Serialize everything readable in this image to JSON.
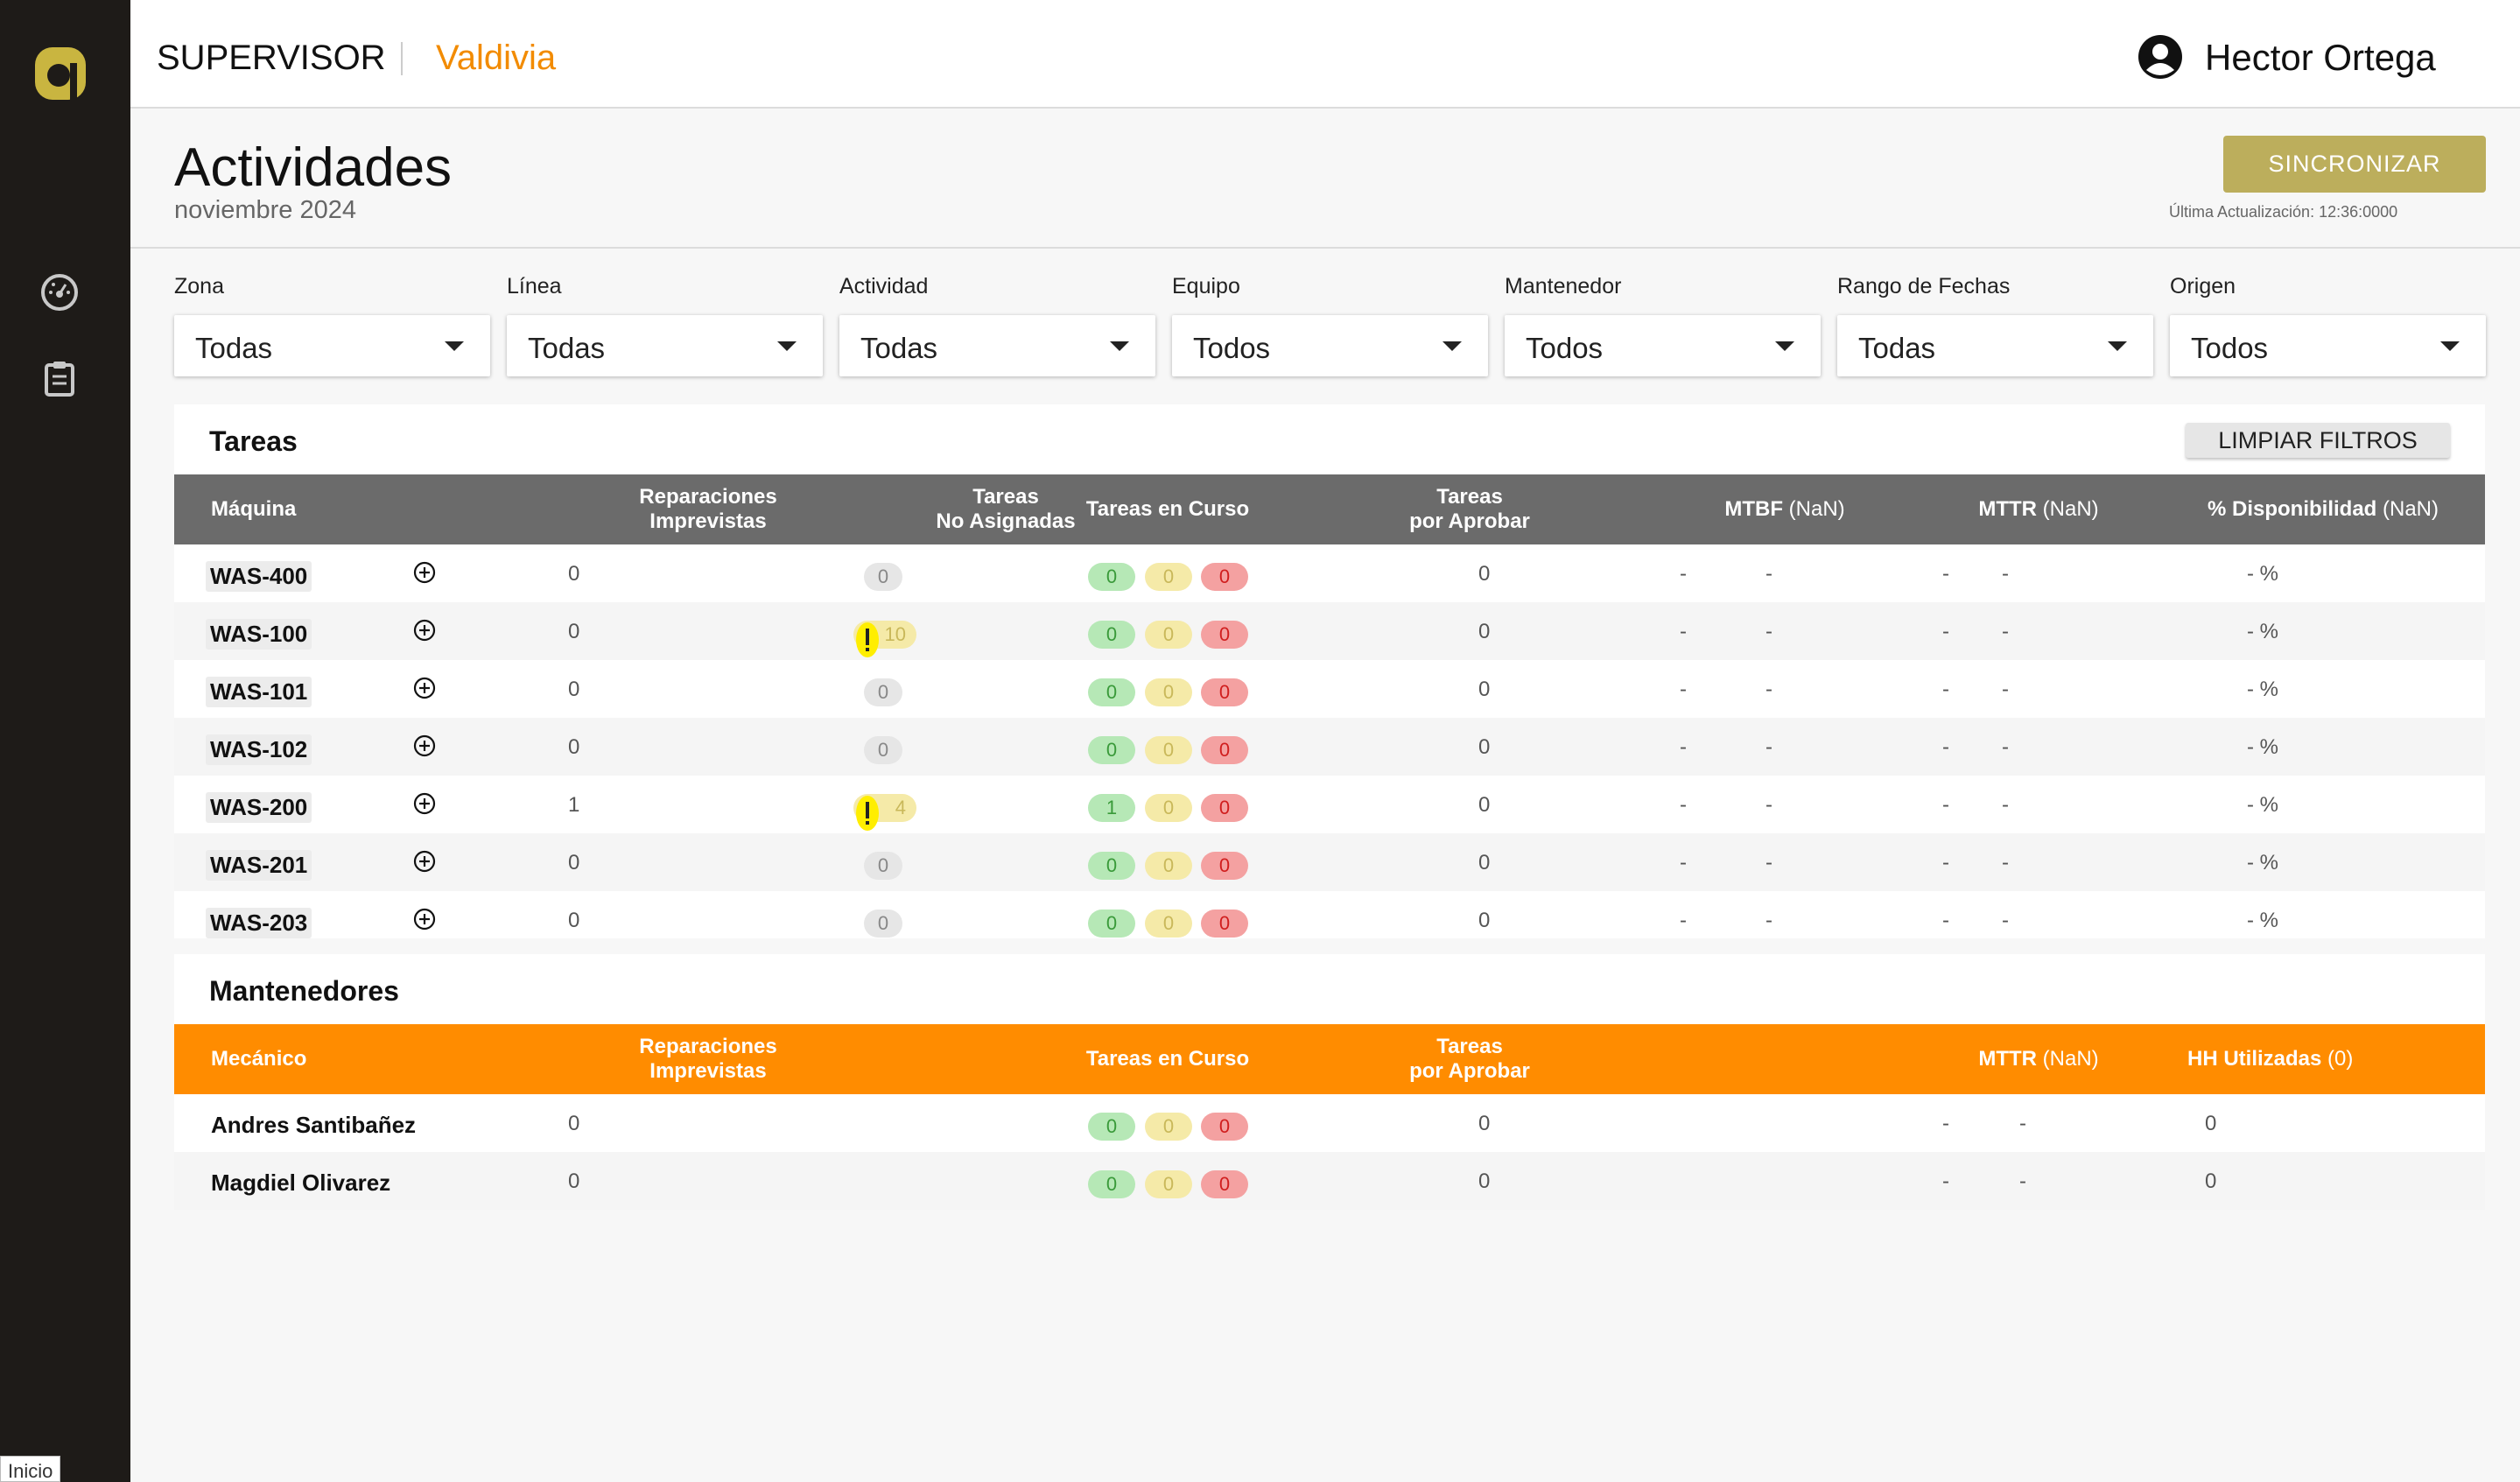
{
  "header": {
    "role": "SUPERVISOR",
    "site": "Valdivia",
    "user": "Hector Ortega"
  },
  "page": {
    "title": "Actividades",
    "period": "noviembre 2024",
    "sync_label": "SINCRONIZAR",
    "last_update": "Última Actualización: 12:36:0000"
  },
  "sidebar": {
    "items": [
      {
        "icon": "dashboard-gauge-icon"
      },
      {
        "icon": "clipboard-icon"
      }
    ],
    "status": "Inicio"
  },
  "filters": [
    {
      "label": "Zona",
      "value": "Todas"
    },
    {
      "label": "Línea",
      "value": "Todas"
    },
    {
      "label": "Actividad",
      "value": "Todas"
    },
    {
      "label": "Equipo",
      "value": "Todos"
    },
    {
      "label": "Mantenedor",
      "value": "Todos"
    },
    {
      "label": "Rango de Fechas",
      "value": "Todas"
    },
    {
      "label": "Origen",
      "value": "Todos"
    }
  ],
  "tasks": {
    "title": "Tareas",
    "clear_label": "LIMPIAR FILTROS",
    "headers": {
      "machine": "Máquina",
      "unplanned_1": "Reparaciones",
      "unplanned_2": "Imprevistas",
      "unassigned_1": "Tareas",
      "unassigned_2": "No Asignadas",
      "in_progress": "Tareas en Curso",
      "approve_1": "Tareas",
      "approve_2": "por Aprobar",
      "mtbf": "MTBF",
      "mtbf_val": "(NaN)",
      "mttr": "MTTR",
      "mttr_val": "(NaN)",
      "avail": "% Disponibilidad",
      "avail_val": "(NaN)"
    },
    "rows": [
      {
        "machine": "WAS-400",
        "unplanned": "0",
        "unassigned": "0",
        "unassigned_warn": false,
        "green": "0",
        "yellow": "0",
        "red": "0",
        "approve": "0",
        "mtbf_a": "-",
        "mtbf_b": "-",
        "mttr_a": "-",
        "mttr_b": "-",
        "avail": "- %"
      },
      {
        "machine": "WAS-100",
        "unplanned": "0",
        "unassigned": "10",
        "unassigned_warn": true,
        "green": "0",
        "yellow": "0",
        "red": "0",
        "approve": "0",
        "mtbf_a": "-",
        "mtbf_b": "-",
        "mttr_a": "-",
        "mttr_b": "-",
        "avail": "- %"
      },
      {
        "machine": "WAS-101",
        "unplanned": "0",
        "unassigned": "0",
        "unassigned_warn": false,
        "green": "0",
        "yellow": "0",
        "red": "0",
        "approve": "0",
        "mtbf_a": "-",
        "mtbf_b": "-",
        "mttr_a": "-",
        "mttr_b": "-",
        "avail": "- %"
      },
      {
        "machine": "WAS-102",
        "unplanned": "0",
        "unassigned": "0",
        "unassigned_warn": false,
        "green": "0",
        "yellow": "0",
        "red": "0",
        "approve": "0",
        "mtbf_a": "-",
        "mtbf_b": "-",
        "mttr_a": "-",
        "mttr_b": "-",
        "avail": "- %"
      },
      {
        "machine": "WAS-200",
        "unplanned": "1",
        "unassigned": "4",
        "unassigned_warn": true,
        "green": "1",
        "yellow": "0",
        "red": "0",
        "approve": "0",
        "mtbf_a": "-",
        "mtbf_b": "-",
        "mttr_a": "-",
        "mttr_b": "-",
        "avail": "- %"
      },
      {
        "machine": "WAS-201",
        "unplanned": "0",
        "unassigned": "0",
        "unassigned_warn": false,
        "green": "0",
        "yellow": "0",
        "red": "0",
        "approve": "0",
        "mtbf_a": "-",
        "mtbf_b": "-",
        "mttr_a": "-",
        "mttr_b": "-",
        "avail": "- %"
      },
      {
        "machine": "WAS-203",
        "unplanned": "0",
        "unassigned": "0",
        "unassigned_warn": false,
        "green": "0",
        "yellow": "0",
        "red": "0",
        "approve": "0",
        "mtbf_a": "-",
        "mtbf_b": "-",
        "mttr_a": "-",
        "mttr_b": "-",
        "avail": "- %"
      }
    ]
  },
  "maint": {
    "title": "Mantenedores",
    "headers": {
      "mechanic": "Mecánico",
      "unplanned_1": "Reparaciones",
      "unplanned_2": "Imprevistas",
      "in_progress": "Tareas en Curso",
      "approve_1": "Tareas",
      "approve_2": "por Aprobar",
      "mttr": "MTTR",
      "mttr_val": "(NaN)",
      "hh": "HH Utilizadas",
      "hh_val": "(0)"
    },
    "rows": [
      {
        "name": "Andres Santibañez",
        "unplanned": "0",
        "green": "0",
        "yellow": "0",
        "red": "0",
        "approve": "0",
        "mttr_a": "-",
        "mttr_b": "-",
        "hh": "0"
      },
      {
        "name": "Magdiel Olivarez",
        "unplanned": "0",
        "green": "0",
        "yellow": "0",
        "red": "0",
        "approve": "0",
        "mttr_a": "-",
        "mttr_b": "-",
        "hh": "0"
      }
    ]
  },
  "colors": {
    "sidebar": "#1e1b18",
    "accent_orange": "#ff8c00",
    "logo": "#c9b540",
    "sync": "#bcae5c",
    "table_header": "#6b6b6b"
  }
}
